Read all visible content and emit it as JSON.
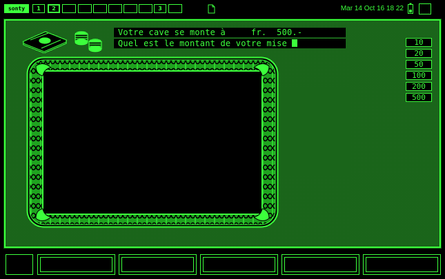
{
  "topbar": {
    "logo_label": "sonty",
    "workspaces": [
      "1",
      "2",
      "",
      "",
      "",
      "",
      "",
      "",
      "",
      "3",
      ""
    ],
    "active_workspace": 1,
    "clock": "Mar 14 Oct  16 18 22"
  },
  "game": {
    "message_line1": "Votre cave se monte à     fr.  500.-",
    "message_line2": "Quel est le montant de votre mise",
    "bet_options": [
      "10",
      "20",
      "50",
      "100",
      "200",
      "500"
    ]
  },
  "bottombar": {
    "buttons": [
      "",
      "",
      "",
      "",
      "",
      ""
    ]
  },
  "colors": {
    "accent": "#3cff3c",
    "background": "#000000",
    "panel_texture": "#0d2a0d"
  },
  "icons": [
    "document-icon",
    "battery-icon",
    "money-stack-icon",
    "coins-icon"
  ]
}
